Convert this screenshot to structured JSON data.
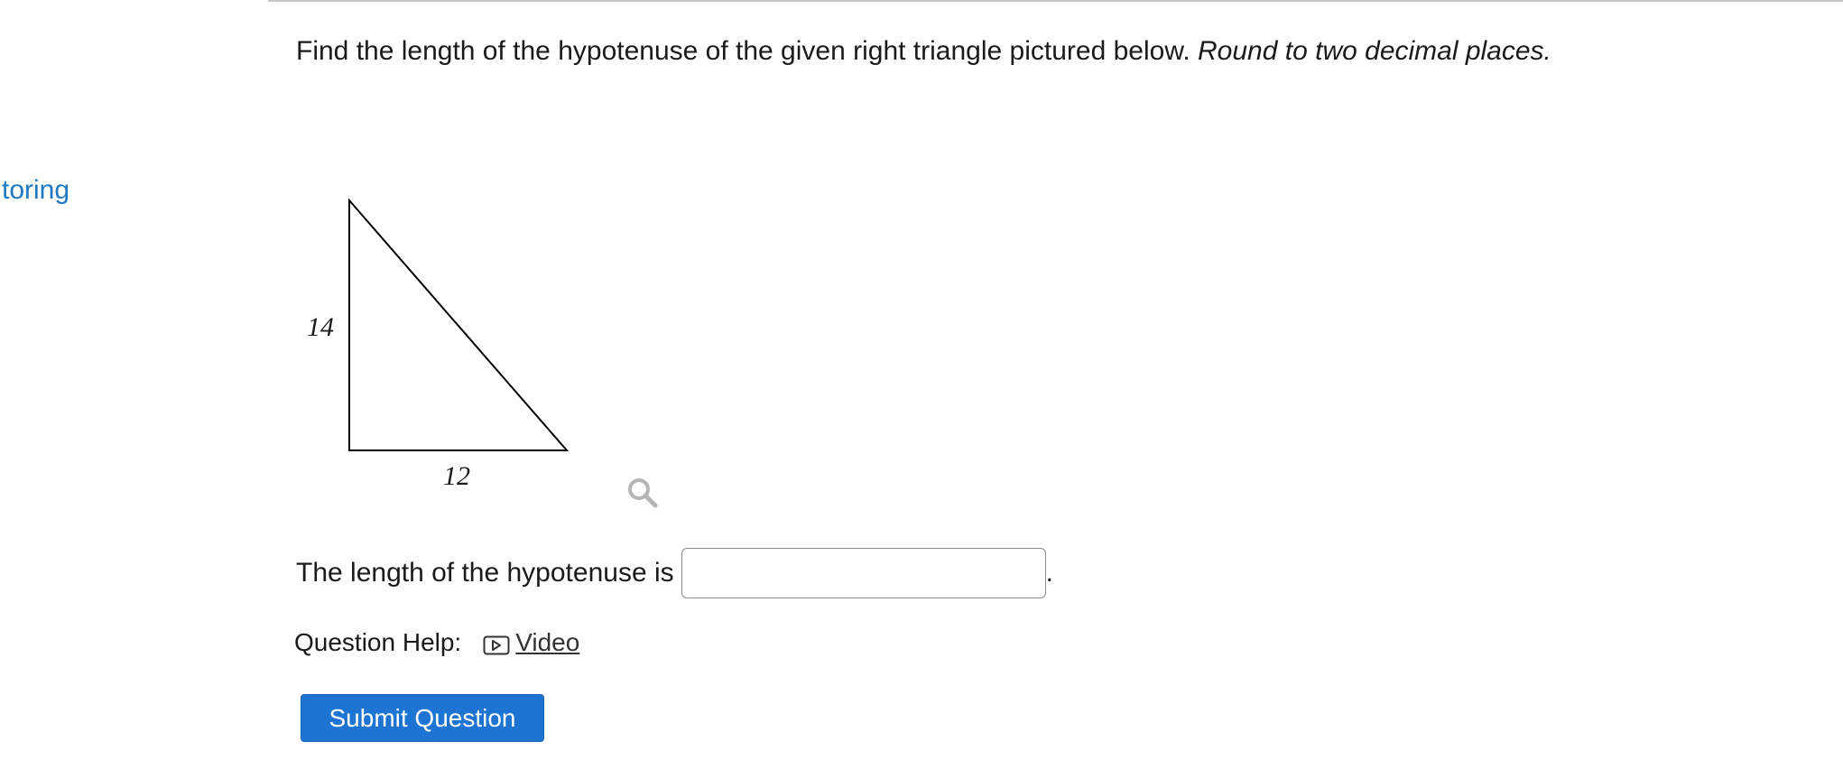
{
  "sidebar": {
    "link_label": "toring"
  },
  "question": {
    "prompt": "Find the length of the hypotenuse of the given right triangle pictured below.",
    "instruction": "Round to two decimal places."
  },
  "figure": {
    "vertical_side_label": "14",
    "horizontal_side_label": "12"
  },
  "answer": {
    "label": "The length of the hypotenuse is",
    "value": "",
    "trailing_punct": "."
  },
  "help": {
    "label": "Question Help:",
    "video_label": "Video"
  },
  "actions": {
    "submit_label": "Submit Question"
  },
  "colors": {
    "link": "#1f78c1",
    "button": "#1e74d2"
  }
}
